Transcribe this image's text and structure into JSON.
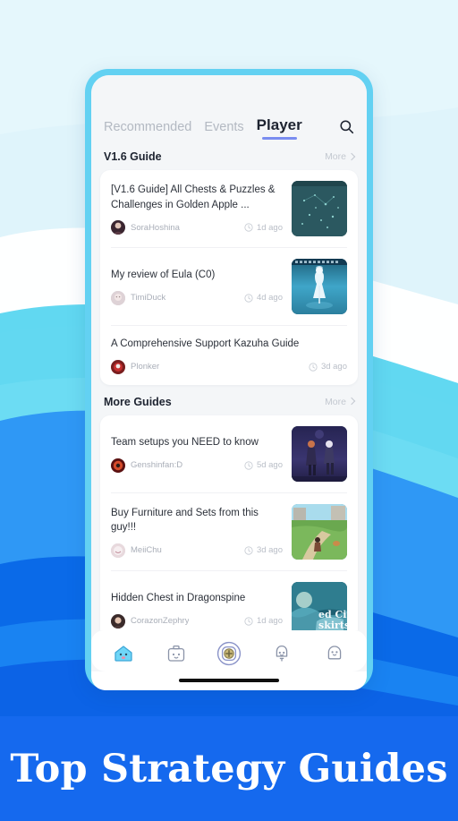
{
  "caption": {
    "text": "Top Strategy Guides"
  },
  "colors": {
    "frame": "#63d1f2",
    "banner_bg": "#1569EE",
    "accent_underline": "#7a8df0",
    "screen_bg": "#f4f6f8",
    "card_bg": "#ffffff",
    "bg_top": "#dff4fb",
    "wave_mid": "#5ad6f0",
    "wave_blue": "#2f98f5",
    "wave_deep": "#0a6ae8"
  },
  "tabs": [
    {
      "label": "Recommended",
      "active": false,
      "name": "tab-recommended"
    },
    {
      "label": "Events",
      "active": false,
      "name": "tab-events"
    },
    {
      "label": "Player",
      "active": true,
      "name": "tab-player"
    }
  ],
  "search": {
    "icon": "search-icon"
  },
  "sections": [
    {
      "title": "V1.6 Guide",
      "more_label": "More",
      "posts": [
        {
          "title": "[V1.6 Guide] All Chests & Puzzles & Challenges in Golden Apple ...",
          "author": "SoraHoshina",
          "time": "1d ago",
          "thumb": "chests-map"
        },
        {
          "title": "My review of Eula (C0)",
          "author": "TimiDuck",
          "time": "4d ago",
          "thumb": "eula-character"
        },
        {
          "title": "A Comprehensive Support Kazuha Guide",
          "author": "Plonker",
          "time": "3d ago",
          "thumb": null
        }
      ]
    },
    {
      "title": "More Guides",
      "more_label": "More",
      "posts": [
        {
          "title": "Team setups you NEED to know",
          "author": "Genshinfan:D",
          "time": "5d ago",
          "thumb": "team-setup"
        },
        {
          "title": "Buy Furniture and Sets from this guy!!!",
          "author": "MeiiChu",
          "time": "3d ago",
          "thumb": "furniture-village"
        },
        {
          "title": "Hidden Chest in Dragonspine",
          "author": "CorazonZephry",
          "time": "1d ago",
          "thumb": "dragonspine-map"
        }
      ]
    }
  ],
  "bottom_nav": {
    "items": [
      {
        "name": "nav-home",
        "icon": "home-ghost-icon",
        "active": true
      },
      {
        "name": "nav-toolbox",
        "icon": "toolbox-icon",
        "active": false
      },
      {
        "name": "nav-add",
        "icon": "add-plus-icon",
        "active": false
      },
      {
        "name": "nav-notifications",
        "icon": "bell-icon",
        "active": false
      },
      {
        "name": "nav-profile",
        "icon": "profile-ghost-icon",
        "active": false
      }
    ]
  },
  "home_indicator": {
    "name": "home-indicator"
  }
}
